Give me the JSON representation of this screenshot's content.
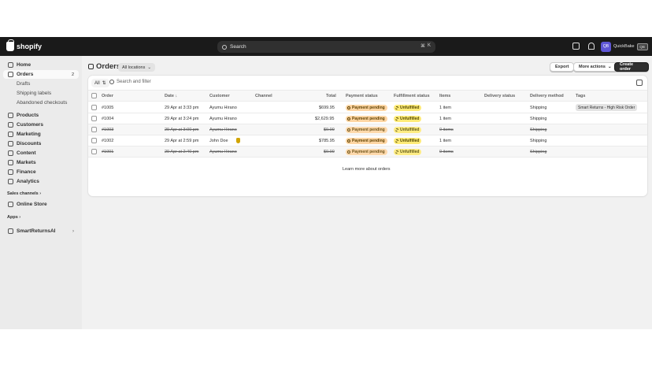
{
  "topbar": {
    "brand": "shopify",
    "search_placeholder": "Search",
    "shortcut_keys": [
      "⌘",
      "K"
    ],
    "store_name": "QuickBake",
    "store_initials": "QB"
  },
  "sidebar": {
    "items": [
      {
        "label": "Home"
      },
      {
        "label": "Orders",
        "badge": "2"
      },
      {
        "label": "Drafts"
      },
      {
        "label": "Shipping labels"
      },
      {
        "label": "Abandoned checkouts"
      },
      {
        "label": "Products"
      },
      {
        "label": "Customers"
      },
      {
        "label": "Marketing"
      },
      {
        "label": "Discounts"
      },
      {
        "label": "Content"
      },
      {
        "label": "Markets"
      },
      {
        "label": "Finance"
      },
      {
        "label": "Analytics"
      }
    ],
    "sales_channels_label": "Sales channels",
    "online_store_label": "Online Store",
    "apps_label": "Apps",
    "app_item_label": "SmartReturnsAI"
  },
  "page": {
    "title": "Orders",
    "location_filter": "All locations",
    "export_label": "Export",
    "more_actions_label": "More actions",
    "create_label": "Create order"
  },
  "table": {
    "tab_all": "All",
    "search_placeholder": "Search and filter",
    "columns": {
      "order": "Order",
      "date": "Date",
      "customer": "Customer",
      "channel": "Channel",
      "total": "Total",
      "payment": "Payment status",
      "fulfillment": "Fulfillment status",
      "items": "Items",
      "delivery_status": "Delivery status",
      "delivery_method": "Delivery method",
      "tags": "Tags"
    },
    "rows": [
      {
        "order": "#1005",
        "date": "29 Apr at 3:33 pm",
        "customer": "Ayumu Hirano",
        "total": "$699.95",
        "payment": "Payment pending",
        "fulfillment": "Unfulfilled",
        "items": "1 item",
        "delivery": "Shipping",
        "tags": "Smart Returns - High Risk Order"
      },
      {
        "order": "#1004",
        "date": "29 Apr at 3:24 pm",
        "customer": "Ayumu Hirano",
        "total": "$2,629.95",
        "payment": "Payment pending",
        "fulfillment": "Unfulfilled",
        "items": "1 item",
        "delivery": "Shipping",
        "tags": ""
      },
      {
        "order": "#1003",
        "date": "29 Apr at 3:00 pm",
        "customer": "Ayumu Hirano",
        "total": "$0.00",
        "payment": "Payment pending",
        "fulfillment": "Unfulfilled",
        "items": "0 items",
        "delivery": "Shipping",
        "tags": ""
      },
      {
        "order": "#1002",
        "date": "29 Apr at 2:59 pm",
        "customer": "John Doe",
        "total": "$785.95",
        "payment": "Payment pending",
        "fulfillment": "Unfulfilled",
        "items": "1 item",
        "delivery": "Shipping",
        "tags": ""
      },
      {
        "order": "#1001",
        "date": "29 Apr at 2:40 pm",
        "customer": "Ayumu Hirano",
        "total": "$0.00",
        "payment": "Payment pending",
        "fulfillment": "Unfulfilled",
        "items": "0 items",
        "delivery": "Shipping",
        "tags": ""
      }
    ]
  },
  "footer_link": "Learn more about orders"
}
